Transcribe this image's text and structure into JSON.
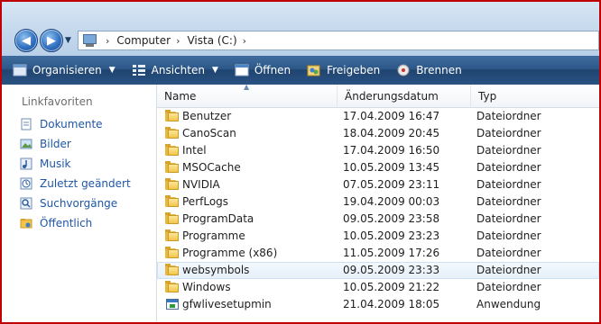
{
  "address_bar": {
    "breadcrumbs": [
      "Computer",
      "Vista (C:)"
    ],
    "separator": "›",
    "back_icon": "back-arrow-icon",
    "forward_icon": "forward-arrow-icon"
  },
  "toolbar": {
    "organize": "Organisieren",
    "views": "Ansichten",
    "open": "Öffnen",
    "share": "Freigeben",
    "burn": "Brennen"
  },
  "sidebar": {
    "heading": "Linkfavoriten",
    "items": [
      {
        "label": "Dokumente",
        "icon": "documents-icon"
      },
      {
        "label": "Bilder",
        "icon": "pictures-icon"
      },
      {
        "label": "Musik",
        "icon": "music-icon"
      },
      {
        "label": "Zuletzt geändert",
        "icon": "recent-icon"
      },
      {
        "label": "Suchvorgänge",
        "icon": "search-icon"
      },
      {
        "label": "Öffentlich",
        "icon": "public-folder-icon"
      }
    ]
  },
  "file_list": {
    "columns": {
      "name": "Name",
      "date": "Änderungsdatum",
      "type": "Typ"
    },
    "rows": [
      {
        "name": "Benutzer",
        "date": "17.04.2009 16:47",
        "type": "Dateiordner",
        "icon": "folder-icon"
      },
      {
        "name": "CanoScan",
        "date": "18.04.2009 20:45",
        "type": "Dateiordner",
        "icon": "folder-icon"
      },
      {
        "name": "Intel",
        "date": "17.04.2009 16:50",
        "type": "Dateiordner",
        "icon": "folder-icon"
      },
      {
        "name": "MSOCache",
        "date": "10.05.2009 13:45",
        "type": "Dateiordner",
        "icon": "folder-icon"
      },
      {
        "name": "NVIDIA",
        "date": "07.05.2009 23:11",
        "type": "Dateiordner",
        "icon": "folder-icon"
      },
      {
        "name": "PerfLogs",
        "date": "19.04.2009 00:03",
        "type": "Dateiordner",
        "icon": "folder-icon"
      },
      {
        "name": "ProgramData",
        "date": "09.05.2009 23:58",
        "type": "Dateiordner",
        "icon": "folder-icon"
      },
      {
        "name": "Programme",
        "date": "10.05.2009 23:23",
        "type": "Dateiordner",
        "icon": "folder-icon"
      },
      {
        "name": "Programme (x86)",
        "date": "11.05.2009 17:26",
        "type": "Dateiordner",
        "icon": "folder-icon"
      },
      {
        "name": "websymbols",
        "date": "09.05.2009 23:33",
        "type": "Dateiordner",
        "icon": "folder-icon",
        "selected": true
      },
      {
        "name": "Windows",
        "date": "10.05.2009 21:22",
        "type": "Dateiordner",
        "icon": "folder-icon"
      },
      {
        "name": "gfwlivesetupmin",
        "date": "21.04.2009 18:05",
        "type": "Anwendung",
        "icon": "application-icon"
      }
    ]
  },
  "colors": {
    "frame": "#c00000",
    "toolbar": "#2d5889",
    "link": "#1f57a8"
  }
}
